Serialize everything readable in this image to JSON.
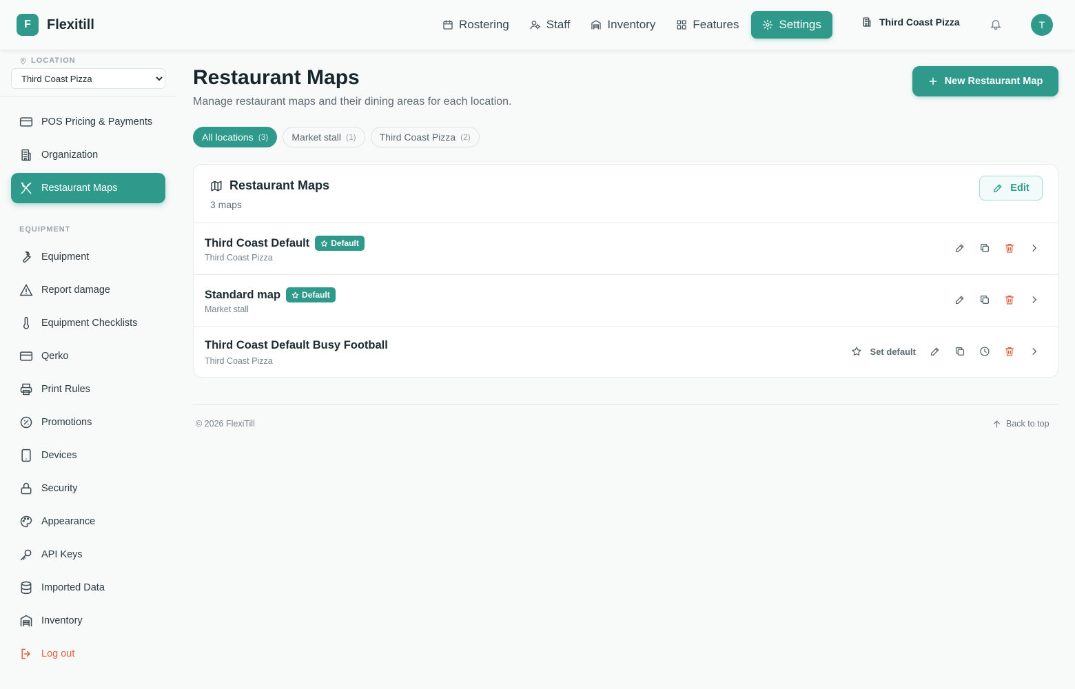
{
  "app": {
    "logo_letter": "F",
    "name": "Flexitill"
  },
  "nav": {
    "items": [
      {
        "label": "Rostering",
        "icon": "calendar-icon"
      },
      {
        "label": "Staff",
        "icon": "users-icon"
      },
      {
        "label": "Inventory",
        "icon": "warehouse-icon"
      },
      {
        "label": "Features",
        "icon": "grid-icon"
      },
      {
        "label": "Settings",
        "icon": "gear-icon",
        "active": true
      }
    ],
    "location": "Third Coast Pizza",
    "avatar_letter": "T"
  },
  "sidebar": {
    "location_label": "LOCATION",
    "location_value": "Third Coast Pizza",
    "items": [
      {
        "label": "POS Pricing & Payments",
        "icon": "credit-card-icon"
      },
      {
        "label": "Organization",
        "icon": "building-icon"
      },
      {
        "label": "Restaurant Maps",
        "icon": "utensils-icon",
        "active": true
      }
    ],
    "section_label": "EQUIPMENT",
    "equipment_items": [
      {
        "label": "Equipment",
        "icon": "wrench-icon"
      },
      {
        "label": "Report damage",
        "icon": "warning-triangle-icon"
      },
      {
        "label": "Equipment Checklists",
        "icon": "thermometer-icon"
      },
      {
        "label": "Qerko",
        "icon": "credit-card-icon"
      },
      {
        "label": "Print Rules",
        "icon": "printer-icon"
      },
      {
        "label": "Promotions",
        "icon": "percent-badge-icon"
      },
      {
        "label": "Devices",
        "icon": "tablet-icon"
      },
      {
        "label": "Security",
        "icon": "lock-icon"
      },
      {
        "label": "Appearance",
        "icon": "palette-icon"
      },
      {
        "label": "API Keys",
        "icon": "key-icon"
      },
      {
        "label": "Imported Data",
        "icon": "database-icon"
      },
      {
        "label": "Inventory",
        "icon": "warehouse-icon"
      }
    ],
    "logout_label": "Log out"
  },
  "main": {
    "title": "Restaurant Maps",
    "subtitle": "Manage restaurant maps and their dining areas for each location.",
    "new_button": "New Restaurant Map",
    "filters": [
      {
        "label": "All locations",
        "count": "(3)",
        "active": true
      },
      {
        "label": "Market stall",
        "count": "(1)"
      },
      {
        "label": "Third Coast Pizza",
        "count": "(2)"
      }
    ],
    "card": {
      "title": "Restaurant Maps",
      "count": "3 maps",
      "edit_label": "Edit",
      "rows": [
        {
          "name": "Third Coast Default",
          "location": "Third Coast Pizza",
          "is_default": true,
          "badge": "Default"
        },
        {
          "name": "Standard map",
          "location": "Market stall",
          "is_default": true,
          "badge": "Default"
        },
        {
          "name": "Third Coast Default Busy Football",
          "location": "Third Coast Pizza",
          "is_default": false,
          "set_default_label": "Set default"
        }
      ]
    }
  },
  "footer": {
    "copyright": "© 2026 FlexiTill",
    "back_to_top": "Back to top"
  },
  "colors": {
    "accent": "#2f9a8c",
    "danger": "#e0623f"
  }
}
